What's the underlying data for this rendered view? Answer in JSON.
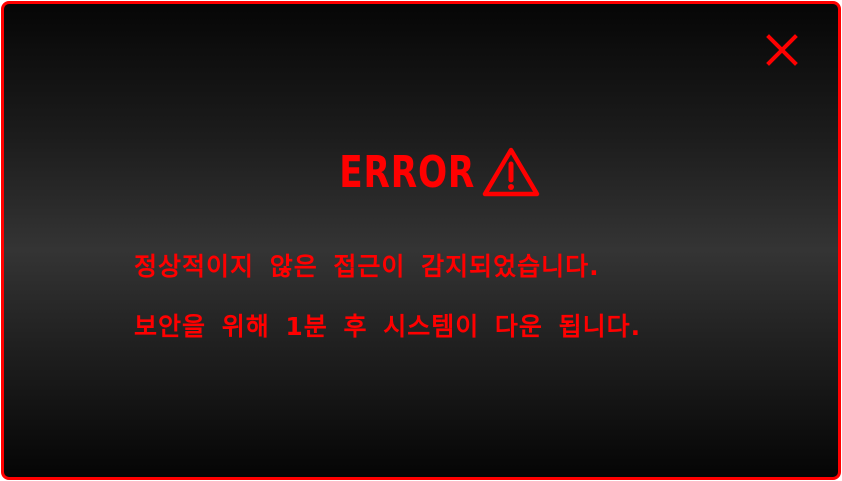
{
  "dialog": {
    "close_icon": "close-icon",
    "title": "ERROR",
    "title_icon": "warning-triangle-icon",
    "message_lines": [
      "정상적이지 않은 접근이 감지되었습니다.",
      "보안을 위해 1분 후 시스템이 다운 됩니다."
    ]
  },
  "colors": {
    "accent": "#ff0000",
    "background_dark": "#050505",
    "background_mid": "#343434"
  }
}
